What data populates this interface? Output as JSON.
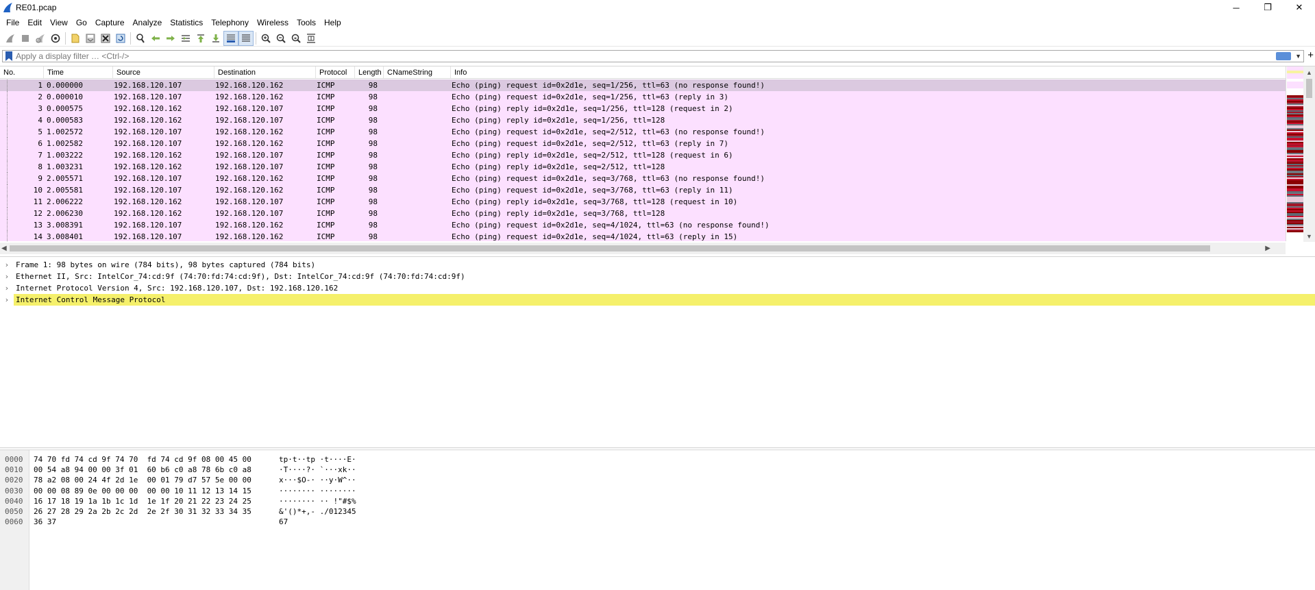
{
  "window": {
    "title": "RE01.pcap",
    "controls": {
      "minimize": "─",
      "restore": "❐",
      "close": "✕"
    }
  },
  "menu": [
    "File",
    "Edit",
    "View",
    "Go",
    "Capture",
    "Analyze",
    "Statistics",
    "Telephony",
    "Wireless",
    "Tools",
    "Help"
  ],
  "toolbar_icons": [
    "shark-start-icon",
    "stop-icon",
    "restart-icon",
    "options-gear-icon",
    "open-file-icon",
    "save-file-icon",
    "close-file-icon",
    "reload-file-icon",
    "find-packet-icon",
    "go-back-icon",
    "go-forward-icon",
    "go-to-packet-icon",
    "go-first-icon",
    "go-last-icon",
    "autoscroll-icon",
    "colorize-icon",
    "zoom-in-icon",
    "zoom-out-icon",
    "zoom-reset-icon",
    "resize-columns-icon"
  ],
  "filter": {
    "placeholder": "Apply a display filter … <Ctrl-/>",
    "value": "",
    "add_label": "+"
  },
  "columns": [
    "No.",
    "Time",
    "Source",
    "Destination",
    "Protocol",
    "Length",
    "CNameString",
    "Info"
  ],
  "packets": [
    {
      "no": "1",
      "time": "0.000000",
      "src": "192.168.120.107",
      "dst": "192.168.120.162",
      "proto": "ICMP",
      "len": "98",
      "cname": "",
      "info": "Echo (ping) request  id=0x2d1e, seq=1/256, ttl=63 (no response found!)",
      "selected": true
    },
    {
      "no": "2",
      "time": "0.000010",
      "src": "192.168.120.107",
      "dst": "192.168.120.162",
      "proto": "ICMP",
      "len": "98",
      "cname": "",
      "info": "Echo (ping) request  id=0x2d1e, seq=1/256, ttl=63 (reply in 3)"
    },
    {
      "no": "3",
      "time": "0.000575",
      "src": "192.168.120.162",
      "dst": "192.168.120.107",
      "proto": "ICMP",
      "len": "98",
      "cname": "",
      "info": "Echo (ping) reply    id=0x2d1e, seq=1/256, ttl=128 (request in 2)"
    },
    {
      "no": "4",
      "time": "0.000583",
      "src": "192.168.120.162",
      "dst": "192.168.120.107",
      "proto": "ICMP",
      "len": "98",
      "cname": "",
      "info": "Echo (ping) reply    id=0x2d1e, seq=1/256, ttl=128"
    },
    {
      "no": "5",
      "time": "1.002572",
      "src": "192.168.120.107",
      "dst": "192.168.120.162",
      "proto": "ICMP",
      "len": "98",
      "cname": "",
      "info": "Echo (ping) request  id=0x2d1e, seq=2/512, ttl=63 (no response found!)"
    },
    {
      "no": "6",
      "time": "1.002582",
      "src": "192.168.120.107",
      "dst": "192.168.120.162",
      "proto": "ICMP",
      "len": "98",
      "cname": "",
      "info": "Echo (ping) request  id=0x2d1e, seq=2/512, ttl=63 (reply in 7)"
    },
    {
      "no": "7",
      "time": "1.003222",
      "src": "192.168.120.162",
      "dst": "192.168.120.107",
      "proto": "ICMP",
      "len": "98",
      "cname": "",
      "info": "Echo (ping) reply    id=0x2d1e, seq=2/512, ttl=128 (request in 6)"
    },
    {
      "no": "8",
      "time": "1.003231",
      "src": "192.168.120.162",
      "dst": "192.168.120.107",
      "proto": "ICMP",
      "len": "98",
      "cname": "",
      "info": "Echo (ping) reply    id=0x2d1e, seq=2/512, ttl=128"
    },
    {
      "no": "9",
      "time": "2.005571",
      "src": "192.168.120.107",
      "dst": "192.168.120.162",
      "proto": "ICMP",
      "len": "98",
      "cname": "",
      "info": "Echo (ping) request  id=0x2d1e, seq=3/768, ttl=63 (no response found!)"
    },
    {
      "no": "10",
      "time": "2.005581",
      "src": "192.168.120.107",
      "dst": "192.168.120.162",
      "proto": "ICMP",
      "len": "98",
      "cname": "",
      "info": "Echo (ping) request  id=0x2d1e, seq=3/768, ttl=63 (reply in 11)"
    },
    {
      "no": "11",
      "time": "2.006222",
      "src": "192.168.120.162",
      "dst": "192.168.120.107",
      "proto": "ICMP",
      "len": "98",
      "cname": "",
      "info": "Echo (ping) reply    id=0x2d1e, seq=3/768, ttl=128 (request in 10)"
    },
    {
      "no": "12",
      "time": "2.006230",
      "src": "192.168.120.162",
      "dst": "192.168.120.107",
      "proto": "ICMP",
      "len": "98",
      "cname": "",
      "info": "Echo (ping) reply    id=0x2d1e, seq=3/768, ttl=128"
    },
    {
      "no": "13",
      "time": "3.008391",
      "src": "192.168.120.107",
      "dst": "192.168.120.162",
      "proto": "ICMP",
      "len": "98",
      "cname": "",
      "info": "Echo (ping) request  id=0x2d1e, seq=4/1024, ttl=63 (no response found!)"
    },
    {
      "no": "14",
      "time": "3.008401",
      "src": "192.168.120.107",
      "dst": "192.168.120.162",
      "proto": "ICMP",
      "len": "98",
      "cname": "",
      "info": "Echo (ping) request  id=0x2d1e, seq=4/1024, ttl=63 (reply in 15)"
    }
  ],
  "details": [
    {
      "text": "Frame 1: 98 bytes on wire (784 bits), 98 bytes captured (784 bits)",
      "highlight": false
    },
    {
      "text": "Ethernet II, Src: IntelCor_74:cd:9f (74:70:fd:74:cd:9f), Dst: IntelCor_74:cd:9f (74:70:fd:74:cd:9f)",
      "highlight": false
    },
    {
      "text": "Internet Protocol Version 4, Src: 192.168.120.107, Dst: 192.168.120.162",
      "highlight": false
    },
    {
      "text": "Internet Control Message Protocol",
      "highlight": true
    }
  ],
  "bytes": [
    {
      "offset": "0000",
      "hex": "74 70 fd 74 cd 9f 74 70  fd 74 cd 9f 08 00 45 00",
      "ascii": "tp·t··tp ·t····E·"
    },
    {
      "offset": "0010",
      "hex": "00 54 a8 94 00 00 3f 01  60 b6 c0 a8 78 6b c0 a8",
      "ascii": "·T····?· `···xk··"
    },
    {
      "offset": "0020",
      "hex": "78 a2 08 00 24 4f 2d 1e  00 01 79 d7 57 5e 00 00",
      "ascii": "x···$O-· ··y·W^··"
    },
    {
      "offset": "0030",
      "hex": "00 00 08 89 0e 00 00 00  00 00 10 11 12 13 14 15",
      "ascii": "········ ········"
    },
    {
      "offset": "0040",
      "hex": "16 17 18 19 1a 1b 1c 1d  1e 1f 20 21 22 23 24 25",
      "ascii": "········ ·· !\"#$%"
    },
    {
      "offset": "0050",
      "hex": "26 27 28 29 2a 2b 2c 2d  2e 2f 30 31 32 33 34 35",
      "ascii": "&'()*+,- ./012345"
    },
    {
      "offset": "0060",
      "hex": "36 37",
      "ascii": "67"
    }
  ],
  "colors": {
    "row_bg": "#fce0ff",
    "row_selected": "#dbc9e0",
    "detail_highlight": "#f5f06b",
    "minimap_dark_red": "#8b0000",
    "minimap_red": "#c8102e",
    "minimap_gray": "#6f7780"
  }
}
